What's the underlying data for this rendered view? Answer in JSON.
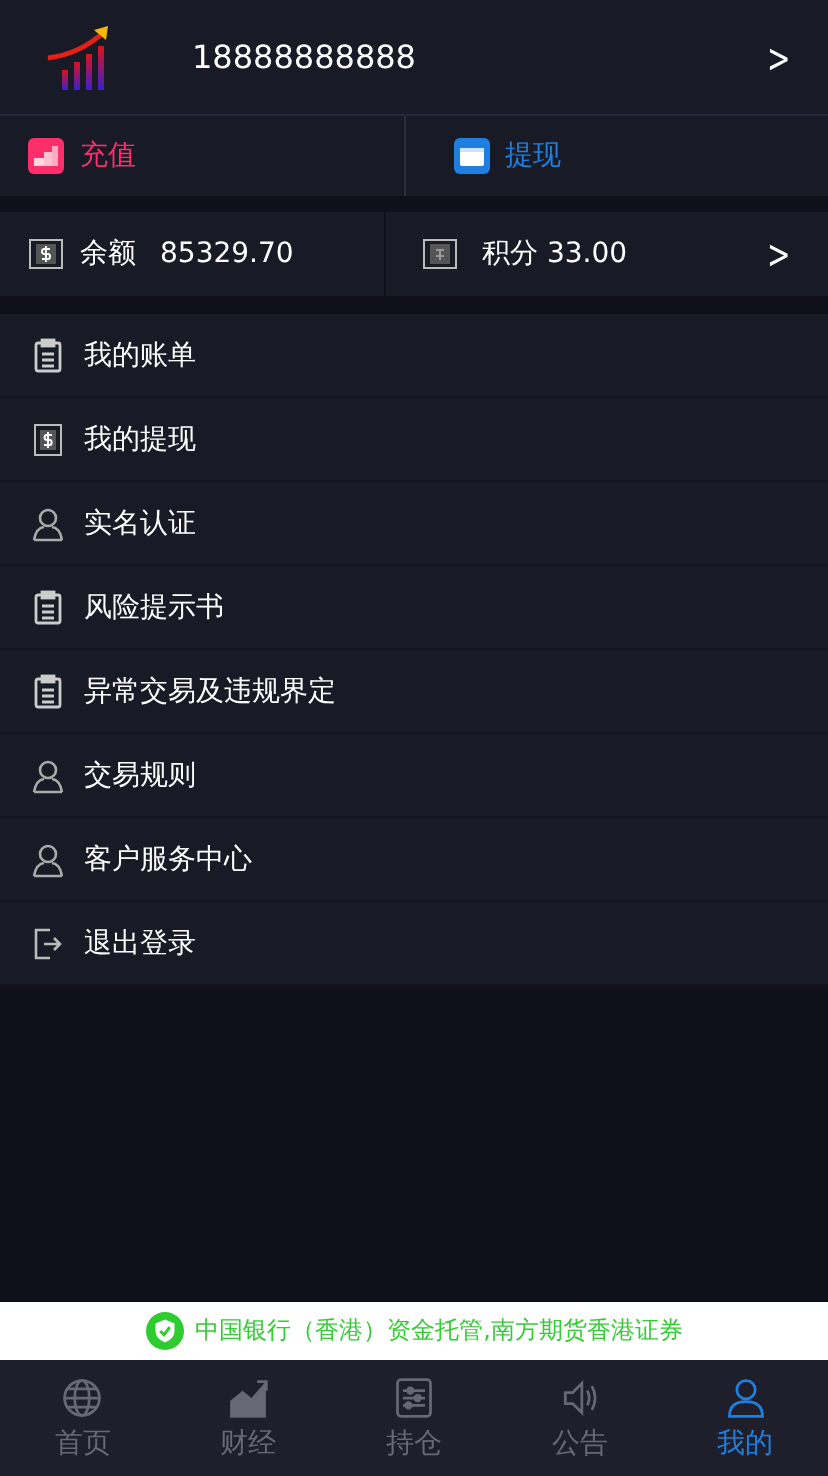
{
  "header": {
    "phone": "18888888888",
    "chevron": ">"
  },
  "actions": [
    {
      "label": "充值",
      "kind": "deposit",
      "color": "#ff2d6a"
    },
    {
      "label": "提现",
      "kind": "withdraw",
      "color": "#1e7fe0"
    }
  ],
  "balance": {
    "label": "余额",
    "value": "85329.70",
    "points": "积分 33.00",
    "chevron": ">"
  },
  "menu": [
    {
      "label": "我的账单",
      "kind": "clipboard"
    },
    {
      "label": "我的提现",
      "kind": "dollar"
    },
    {
      "label": "实名认证",
      "kind": "person"
    },
    {
      "label": "风险提示书",
      "kind": "clipboard"
    },
    {
      "label": "异常交易及违规界定",
      "kind": "clipboard"
    },
    {
      "label": "交易规则",
      "kind": "person"
    },
    {
      "label": "客户服务中心",
      "kind": "person"
    },
    {
      "label": "退出登录",
      "kind": "logout"
    }
  ],
  "banner": {
    "text": "中国银行（香港）资金托管,南方期货香港证券"
  },
  "nav": [
    {
      "label": "首页",
      "kind": "globe",
      "selected": false
    },
    {
      "label": "财经",
      "kind": "chart",
      "selected": false
    },
    {
      "label": "持仓",
      "kind": "sliders",
      "selected": false
    },
    {
      "label": "公告",
      "kind": "speaker",
      "selected": false
    },
    {
      "label": "我的",
      "kind": "person",
      "selected": true
    }
  ]
}
